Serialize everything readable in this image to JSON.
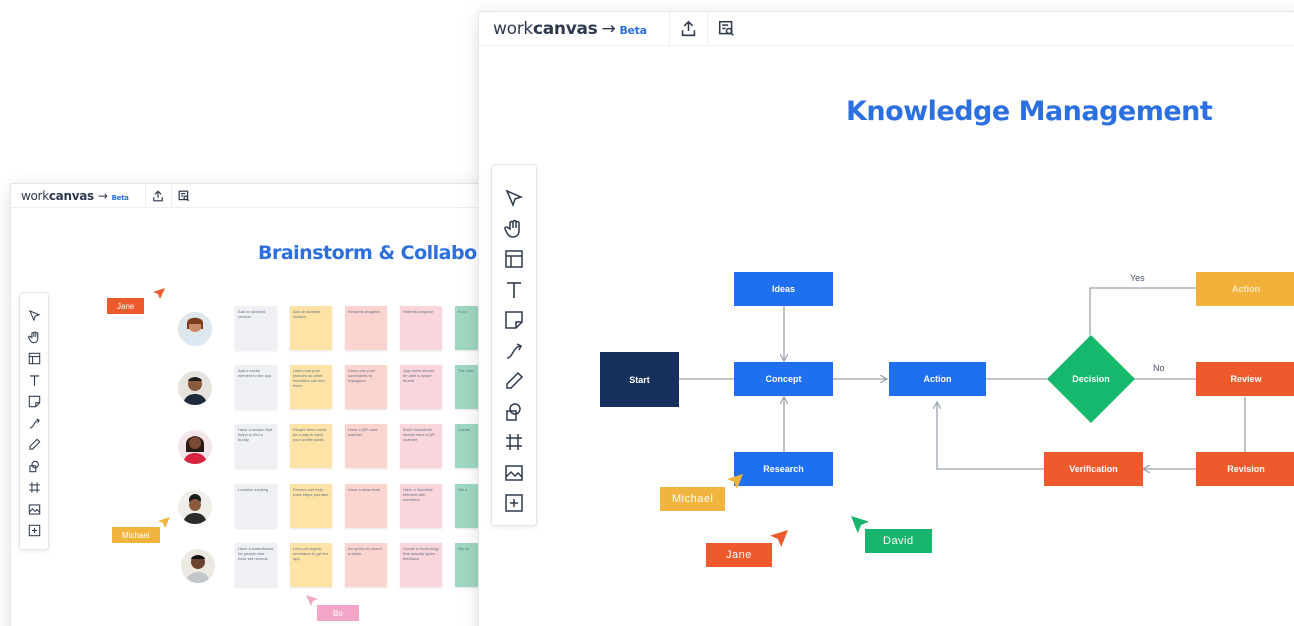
{
  "back_window": {
    "brand": {
      "light": "work",
      "bold": "canvas",
      "arrow": "→",
      "beta": "Beta"
    },
    "title": "Brainstorm & Collabor",
    "cursors": {
      "jane": "Jane",
      "michael": "Michael",
      "bo": "Bo"
    },
    "notes": [
      [
        "Add an Android version",
        "Add an Android version",
        "Rewards program",
        "Referral program",
        "If a p"
      ],
      [
        "Add a social element to the app",
        "Users can post pictures so other members can see them",
        "Users can post summaries to Instagram",
        "App users should be able to share thumb",
        "The user"
      ],
      [
        "Have a section that helps to find a buddy",
        "People there could be a way to track your profile public",
        "Have a QR code scanner",
        "Each household should have a QR scanner",
        "Create"
      ],
      [
        "Location tracking",
        "Phones can help track steps you take",
        "Have a news feed",
        "Have a 'favorites' element with members",
        "We c"
      ],
      [
        "Have a leaderboard for people who have set records",
        "Let's put regular reminders to get the app",
        "An option to record a video",
        "Create a technology that actually gives feedback",
        "We co"
      ]
    ]
  },
  "front_window": {
    "brand": {
      "light": "work",
      "bold": "canvas",
      "arrow": "→",
      "beta": "Beta"
    },
    "title": "Knowledge Management",
    "flow": {
      "start": "Start",
      "ideas": "Ideas",
      "concept": "Concept",
      "research": "Research",
      "action_main": "Action",
      "decision": "Decision",
      "action_top": "Action",
      "review": "Review",
      "revision": "Revision",
      "verification": "Verification",
      "yes": "Yes",
      "no": "No"
    },
    "cursors": {
      "michael": "Michael",
      "jane": "Jane",
      "david": "David"
    }
  },
  "colors": {
    "brand_blue": "#2b6fe0",
    "node_blue": "#1f6ff2",
    "node_navy": "#16305c",
    "decision_green": "#15b86c",
    "orange_red": "#ee5a2c",
    "amber": "#f2b13a",
    "cursor_orange": "#ee5a2c",
    "cursor_amber": "#f1b43e",
    "cursor_green": "#16b46c",
    "cursor_pink": "#f4a6c8"
  },
  "icons": {
    "toolbar": [
      "share-upload-icon",
      "presentation-search-icon"
    ],
    "tools": [
      "select-pointer-icon",
      "hand-pan-icon",
      "template-layout-icon",
      "text-icon",
      "sticky-note-icon",
      "connector-arrow-icon",
      "pen-icon",
      "shapes-icon",
      "frame-grid-icon",
      "image-icon",
      "add-plus-icon"
    ]
  }
}
